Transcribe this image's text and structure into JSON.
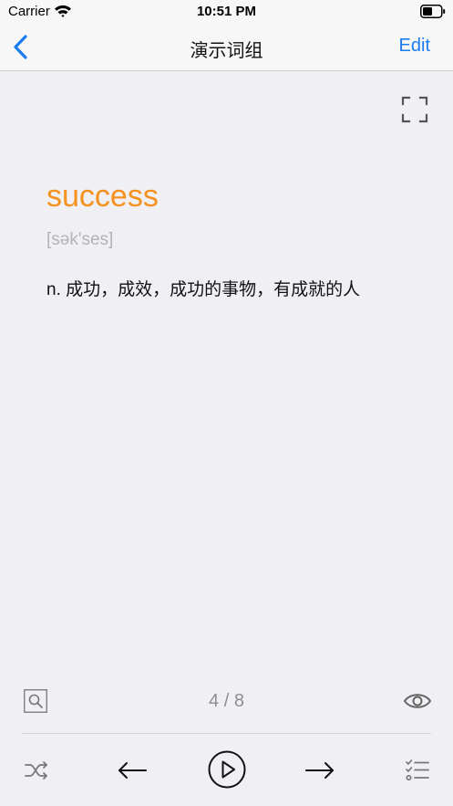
{
  "status_bar": {
    "carrier": "Carrier",
    "time": "10:51 PM"
  },
  "nav": {
    "title": "演示词组",
    "edit_label": "Edit"
  },
  "card": {
    "word": "success",
    "phonetic": "[sək'ses]",
    "definition": "n. 成功，成效，成功的事物，有成就的人"
  },
  "footer": {
    "counter": "4 / 8"
  },
  "colors": {
    "accent": "#1a7cf0",
    "word": "#f5921e",
    "phonetic": "#b3b3b8",
    "background": "#efeff4"
  },
  "icons": [
    "wifi-icon",
    "battery-icon",
    "back-chevron-icon",
    "fullscreen-icon",
    "search-icon",
    "eye-icon",
    "shuffle-icon",
    "arrow-left-icon",
    "play-icon",
    "arrow-right-icon",
    "checklist-icon"
  ]
}
